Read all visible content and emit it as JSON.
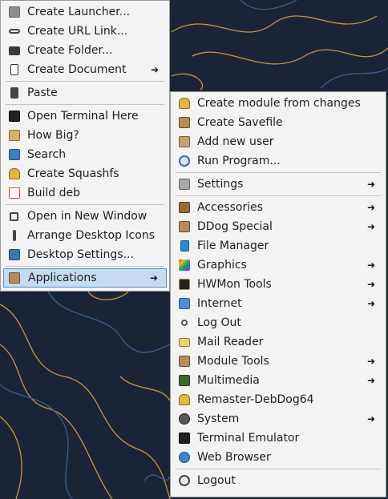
{
  "desktop_menu": {
    "items": [
      {
        "label": "Create Launcher...",
        "icon": "launcher-icon"
      },
      {
        "label": "Create URL Link...",
        "icon": "link-icon"
      },
      {
        "label": "Create Folder...",
        "icon": "folder-icon"
      },
      {
        "label": "Create Document",
        "icon": "document-icon",
        "submenu": true
      },
      {
        "label": "Paste",
        "icon": "paste-icon"
      },
      {
        "label": "Open Terminal Here",
        "icon": "terminal-icon"
      },
      {
        "label": "How Big?",
        "icon": "disk-usage-icon"
      },
      {
        "label": "Search",
        "icon": "search-icon"
      },
      {
        "label": "Create Squashfs",
        "icon": "squashfs-icon"
      },
      {
        "label": "Build deb",
        "icon": "deb-package-icon"
      },
      {
        "label": "Open in New Window",
        "icon": "new-window-icon"
      },
      {
        "label": "Arrange Desktop Icons",
        "icon": "arrange-icon"
      },
      {
        "label": "Desktop Settings...",
        "icon": "desktop-settings-icon"
      },
      {
        "label": "Applications",
        "icon": "applications-icon",
        "submenu": true,
        "active": true
      }
    ]
  },
  "applications_menu": {
    "items": [
      {
        "label": "Create module from changes",
        "icon": "module-icon"
      },
      {
        "label": "Create Savefile",
        "icon": "savefile-icon"
      },
      {
        "label": "Add new user",
        "icon": "add-user-icon"
      },
      {
        "label": "Run Program...",
        "icon": "run-program-icon"
      },
      {
        "label": "Settings",
        "icon": "settings-icon",
        "submenu": true
      },
      {
        "label": "Accessories",
        "icon": "accessories-icon",
        "submenu": true
      },
      {
        "label": "DDog Special",
        "icon": "ddog-icon",
        "submenu": true
      },
      {
        "label": "File Manager",
        "icon": "file-manager-icon"
      },
      {
        "label": "Graphics",
        "icon": "graphics-icon",
        "submenu": true
      },
      {
        "label": "HWMon Tools",
        "icon": "hwmon-icon",
        "submenu": true
      },
      {
        "label": "Internet",
        "icon": "internet-icon",
        "submenu": true
      },
      {
        "label": "Log Out",
        "icon": "logout-small-icon"
      },
      {
        "label": "Mail Reader",
        "icon": "mail-icon"
      },
      {
        "label": "Module Tools",
        "icon": "module-tools-icon",
        "submenu": true
      },
      {
        "label": "Multimedia",
        "icon": "multimedia-icon",
        "submenu": true
      },
      {
        "label": "Remaster-DebDog64",
        "icon": "remaster-icon"
      },
      {
        "label": "System",
        "icon": "system-icon",
        "submenu": true
      },
      {
        "label": "Terminal Emulator",
        "icon": "terminal-emulator-icon"
      },
      {
        "label": "Web Browser",
        "icon": "web-browser-icon"
      },
      {
        "label": "Logout",
        "icon": "logout-icon"
      }
    ]
  },
  "submenu_arrow": "➜",
  "colors": {
    "desktop_background": "#1b2436",
    "menu_background": "#f3f3f3",
    "highlight": "#c3dcf1",
    "highlight_border": "#5d8fc0",
    "contour_orange": "#c9943a",
    "contour_blue": "#3a5f92"
  }
}
